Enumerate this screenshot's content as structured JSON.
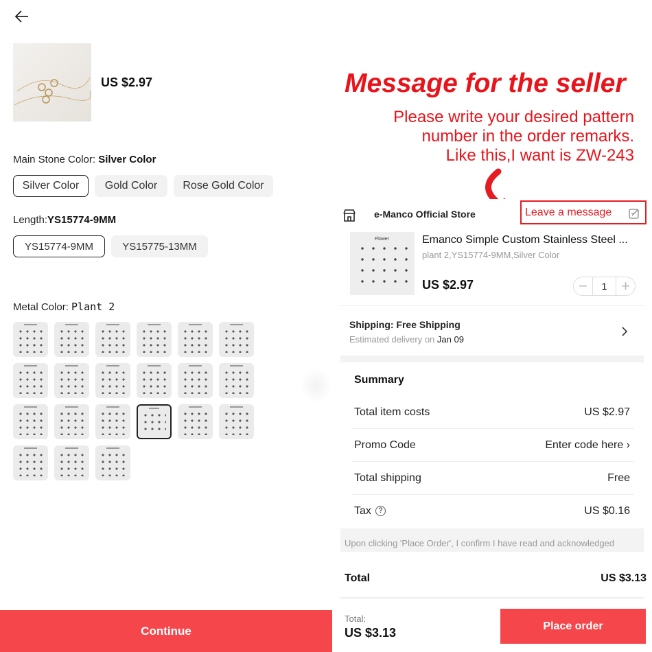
{
  "left": {
    "price": "US $2.97",
    "main_stone": {
      "label": "Main Stone Color:",
      "value": "Silver Color",
      "options": [
        "Silver Color",
        "Gold Color",
        "Rose Gold Color"
      ],
      "selected_index": 0
    },
    "length": {
      "label": "Length:",
      "value": "YS15774-9MM",
      "options": [
        "YS15774-9MM",
        "YS15775-13MM"
      ],
      "selected_index": 0
    },
    "metal_color": {
      "label": "Metal Color:",
      "value": "Plant 2",
      "pattern_count": 21,
      "selected_index": 15
    },
    "continue_label": "Continue"
  },
  "promo": {
    "title": "Message for the seller",
    "line1": "Please write your desired pattern",
    "line2": "number in the order remarks.",
    "line3": "Like this,I want is ZW-243",
    "color": "#e8141b"
  },
  "order": {
    "store_name": "e-Manco Official Store",
    "leave_message": "Leave a message",
    "product": {
      "title": "Emanco Simple Custom Stainless Steel ...",
      "image_title": "Flower",
      "variant": "plant 2,YS15774-9MM,Silver Color",
      "price": "US $2.97",
      "quantity": "1"
    },
    "shipping": {
      "title": "Shipping: Free Shipping",
      "estimate_label": "Estimated delivery on",
      "estimate_date": "Jan 09"
    },
    "summary": {
      "title": "Summary",
      "rows": [
        {
          "label": "Total item costs",
          "value": "US $2.97"
        },
        {
          "label": "Promo Code",
          "value": "Enter code here"
        },
        {
          "label": "Total shipping",
          "value": "Free"
        },
        {
          "label": "Tax",
          "value": "US $0.16"
        }
      ]
    },
    "disclaimer": "Upon clicking 'Place Order', I confirm I have read and acknowledged",
    "total_label": "Total",
    "total_value": "US $3.13",
    "bottom_total_label": "Total:",
    "bottom_total_value": "US $3.13",
    "place_order_label": "Place order"
  },
  "colors": {
    "accent_red": "#f5474b",
    "promo_red": "#e8141b"
  }
}
